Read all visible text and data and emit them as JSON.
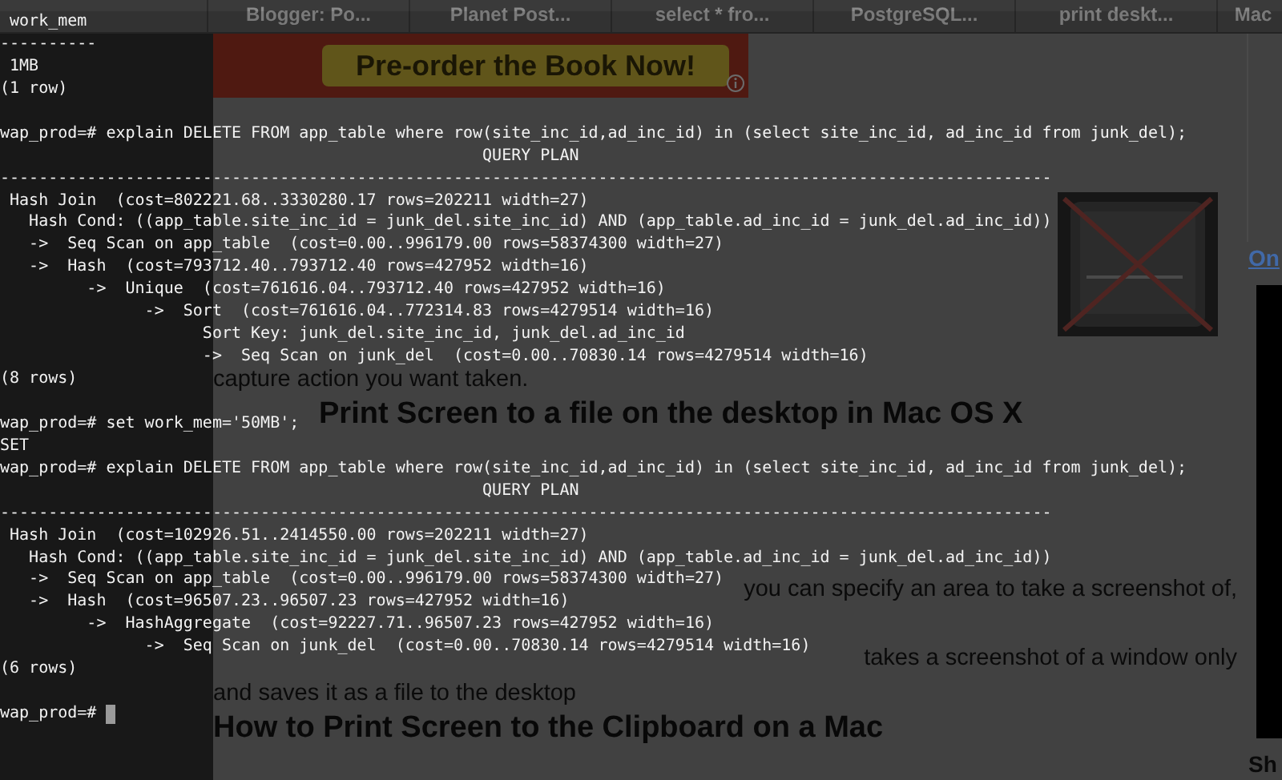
{
  "browser": {
    "tabs": [
      {
        "kind": "hidden"
      },
      {
        "kind": "tab",
        "label": "Blogger: Po..."
      },
      {
        "kind": "tab",
        "label": "Planet Post..."
      },
      {
        "kind": "tab",
        "label": "select * fro..."
      },
      {
        "kind": "tab",
        "label": "PostgreSQL..."
      },
      {
        "kind": "tab",
        "label": "print deskt..."
      },
      {
        "kind": "tab",
        "label": "Mac"
      }
    ],
    "banner": {
      "button": "Pre-order the Book Now!"
    },
    "article": {
      "intro": [
        {
          "kind": "line",
          "text": "capture action you want taken."
        }
      ],
      "sections": [
        {
          "heading": {
            "kind": "partial",
            "text": "Print Screen to a file on the desktop in Mac OS X"
          },
          "lines": [
            {
              "kind": "gap"
            },
            {
              "kind": "gap"
            },
            {
              "kind": "gap"
            },
            {
              "kind": "gap"
            },
            {
              "kind": "fragment",
              "text": "you can specify an area to take a screenshot of,"
            },
            {
              "kind": "gap"
            },
            {
              "kind": "fragment",
              "text": "takes a screenshot of a window only"
            },
            {
              "kind": "line",
              "text": "and saves it as a file to the desktop"
            }
          ]
        },
        {
          "heading": {
            "kind": "full",
            "text": "How to Print Screen to the Clipboard on a Mac"
          }
        }
      ]
    },
    "sidebar": {
      "link": "On",
      "heading": "Sh"
    }
  },
  "terminal": {
    "lines": [
      {
        "kind": "text",
        "text": " work_mem"
      },
      {
        "kind": "text",
        "text": "----------"
      },
      {
        "kind": "text",
        "text": " 1MB"
      },
      {
        "kind": "text",
        "text": "(1 row)"
      },
      {
        "kind": "blank"
      },
      {
        "kind": "text",
        "text": "wap_prod=# explain DELETE FROM app_table where row(site_inc_id,ad_inc_id) in (select site_inc_id, ad_inc_id from junk_del);"
      },
      {
        "kind": "text",
        "text": "                                                  QUERY PLAN"
      },
      {
        "kind": "text",
        "text": "-------------------------------------------------------------------------------------------------------------"
      },
      {
        "kind": "text",
        "text": " Hash Join  (cost=802221.68..3330280.17 rows=202211 width=27)"
      },
      {
        "kind": "text",
        "text": "   Hash Cond: ((app_table.site_inc_id = junk_del.site_inc_id) AND (app_table.ad_inc_id = junk_del.ad_inc_id))"
      },
      {
        "kind": "text",
        "text": "   ->  Seq Scan on app_table  (cost=0.00..996179.00 rows=58374300 width=27)"
      },
      {
        "kind": "text",
        "text": "   ->  Hash  (cost=793712.40..793712.40 rows=427952 width=16)"
      },
      {
        "kind": "text",
        "text": "         ->  Unique  (cost=761616.04..793712.40 rows=427952 width=16)"
      },
      {
        "kind": "text",
        "text": "               ->  Sort  (cost=761616.04..772314.83 rows=4279514 width=16)"
      },
      {
        "kind": "text",
        "text": "                     Sort Key: junk_del.site_inc_id, junk_del.ad_inc_id"
      },
      {
        "kind": "text",
        "text": "                     ->  Seq Scan on junk_del  (cost=0.00..70830.14 rows=4279514 width=16)"
      },
      {
        "kind": "text",
        "text": "(8 rows)"
      },
      {
        "kind": "blank"
      },
      {
        "kind": "text",
        "text": "wap_prod=# set work_mem='50MB';"
      },
      {
        "kind": "text",
        "text": "SET"
      },
      {
        "kind": "text",
        "text": "wap_prod=# explain DELETE FROM app_table where row(site_inc_id,ad_inc_id) in (select site_inc_id, ad_inc_id from junk_del);"
      },
      {
        "kind": "text",
        "text": "                                                  QUERY PLAN"
      },
      {
        "kind": "text",
        "text": "-------------------------------------------------------------------------------------------------------------"
      },
      {
        "kind": "text",
        "text": " Hash Join  (cost=102926.51..2414550.00 rows=202211 width=27)"
      },
      {
        "kind": "text",
        "text": "   Hash Cond: ((app_table.site_inc_id = junk_del.site_inc_id) AND (app_table.ad_inc_id = junk_del.ad_inc_id))"
      },
      {
        "kind": "text",
        "text": "   ->  Seq Scan on app_table  (cost=0.00..996179.00 rows=58374300 width=27)"
      },
      {
        "kind": "text",
        "text": "   ->  Hash  (cost=96507.23..96507.23 rows=427952 width=16)"
      },
      {
        "kind": "text",
        "text": "         ->  HashAggregate  (cost=92227.71..96507.23 rows=427952 width=16)"
      },
      {
        "kind": "text",
        "text": "               ->  Seq Scan on junk_del  (cost=0.00..70830.14 rows=4279514 width=16)"
      },
      {
        "kind": "text",
        "text": "(6 rows)"
      },
      {
        "kind": "blank"
      },
      {
        "kind": "prompt",
        "text": "wap_prod=# "
      }
    ]
  }
}
